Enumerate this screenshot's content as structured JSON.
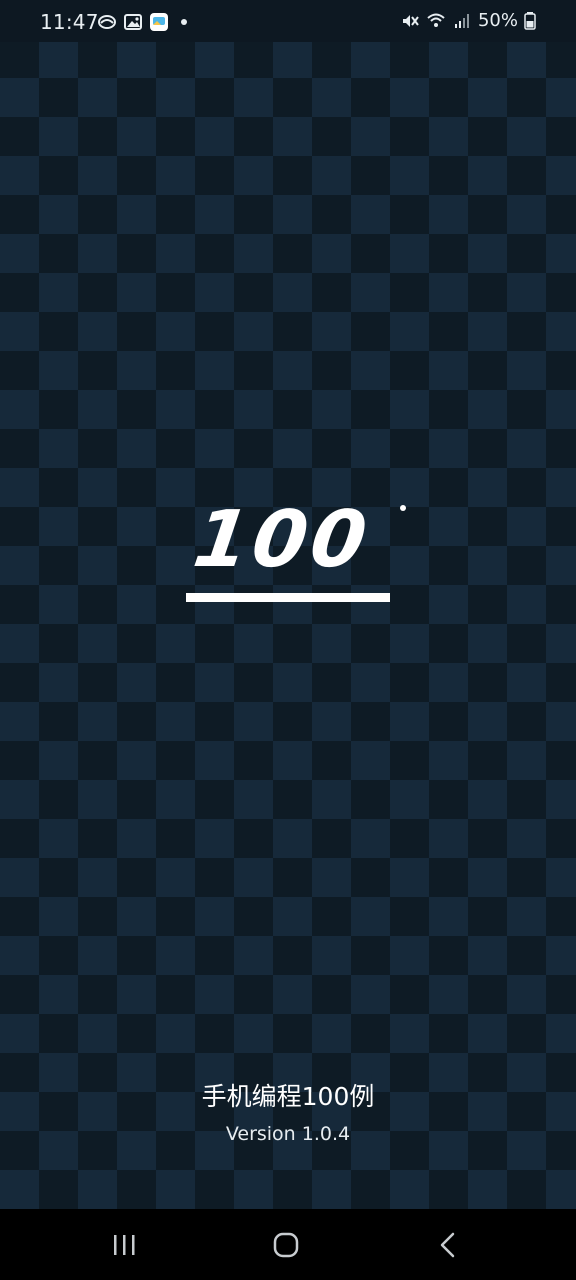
{
  "status_bar": {
    "time": "11:47",
    "battery": "50%",
    "left_icons": [
      "cloud-icon",
      "image-icon",
      "photo-app-icon",
      "dot-icon"
    ],
    "right_icons": [
      "mute-icon",
      "wifi-icon",
      "signal-icon",
      "battery-icon"
    ]
  },
  "splash": {
    "logo_text": "100",
    "app_title": "手机编程100例",
    "version": "Version 1.0.4"
  },
  "nav_bar": {
    "buttons": [
      "recents-button",
      "home-button",
      "back-button"
    ]
  },
  "colors": {
    "background_dark": "#0e1b25",
    "checker_light": "#16293a",
    "text": "#ffffff",
    "nav_bar": "#000000"
  }
}
